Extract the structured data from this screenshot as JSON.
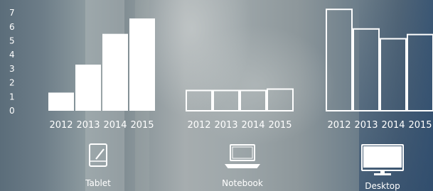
{
  "chart_data": [
    {
      "type": "bar",
      "device": "Tablet",
      "icon": "tablet-icon",
      "fill": "solid",
      "categories": [
        "2012",
        "2013",
        "2014",
        "2015"
      ],
      "values": [
        1.3,
        3.3,
        5.5,
        6.6
      ],
      "yticks": [
        "0",
        "1",
        "2",
        "3",
        "4",
        "5",
        "6",
        "7"
      ],
      "ylim": [
        0,
        7
      ],
      "title": "",
      "xlabel": "",
      "ylabel": ""
    },
    {
      "type": "bar",
      "device": "Notebook",
      "icon": "notebook-icon",
      "fill": "outline",
      "categories": [
        "2012",
        "2013",
        "2014",
        "2015"
      ],
      "values": [
        1.5,
        1.5,
        1.5,
        1.6
      ],
      "ylim": [
        0,
        7
      ],
      "title": "",
      "xlabel": "",
      "ylabel": ""
    },
    {
      "type": "bar",
      "device": "Desktop",
      "icon": "desktop-icon",
      "fill": "outline",
      "categories": [
        "2012",
        "2013",
        "2014",
        "2015"
      ],
      "values": [
        7.3,
        5.9,
        5.2,
        5.5
      ],
      "ylim": [
        0,
        7
      ],
      "title": "",
      "xlabel": "",
      "ylabel": ""
    }
  ],
  "colors": {
    "bars": "#ffffff"
  }
}
